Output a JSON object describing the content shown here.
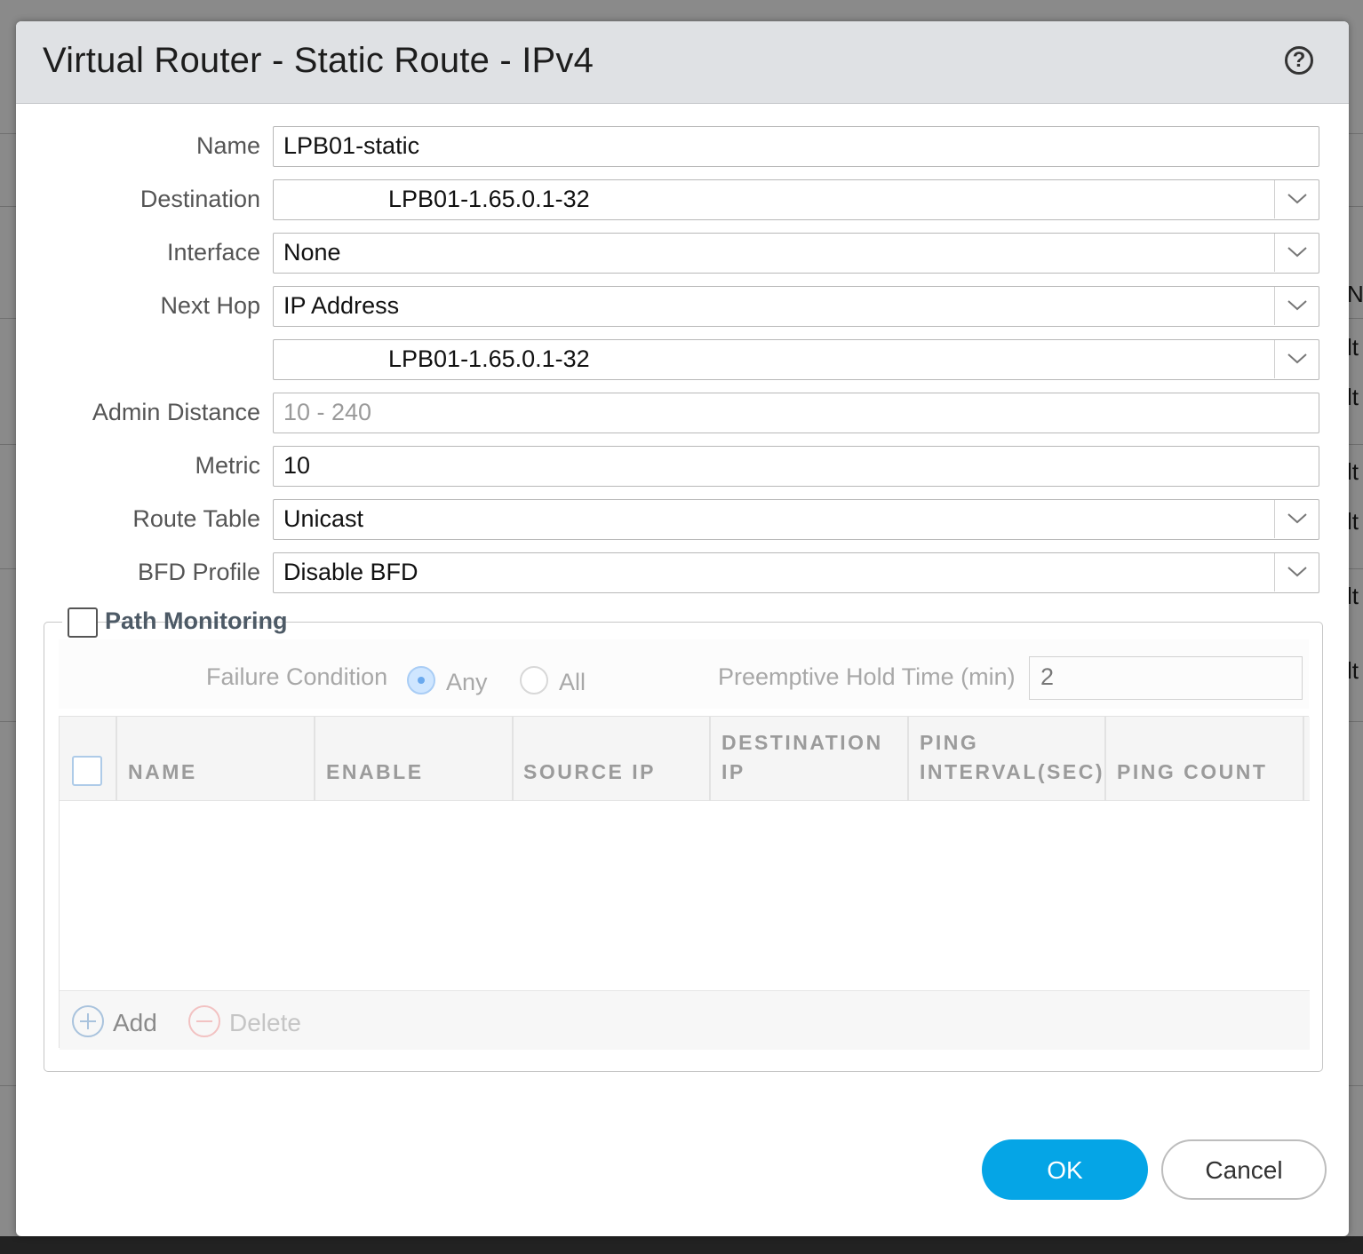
{
  "dialog": {
    "title": "Virtual Router - Static Route - IPv4",
    "help_glyph": "?"
  },
  "form": {
    "name_label": "Name",
    "name_value": "LPB01-static",
    "destination_label": "Destination",
    "destination_value": "LPB01-1.65.0.1-32",
    "interface_label": "Interface",
    "interface_value": "None",
    "next_hop_label": "Next Hop",
    "next_hop_type": "IP Address",
    "next_hop_value": "LPB01-1.65.0.1-32",
    "admin_distance_label": "Admin Distance",
    "admin_distance_placeholder": "10 - 240",
    "metric_label": "Metric",
    "metric_value": "10",
    "route_table_label": "Route Table",
    "route_table_value": "Unicast",
    "bfd_profile_label": "BFD Profile",
    "bfd_profile_value": "Disable BFD"
  },
  "path_monitoring": {
    "label": "Path Monitoring",
    "checked": false,
    "failure_condition_label": "Failure Condition",
    "option_any": "Any",
    "option_all": "All",
    "selected": "Any",
    "preemptive_label": "Preemptive Hold Time (min)",
    "preemptive_value": "2",
    "columns": [
      "NAME",
      "ENABLE",
      "SOURCE IP",
      "DESTINATION IP",
      "PING INTERVAL(SEC)",
      "PING COUNT"
    ],
    "col_dest_line1": "DESTINATION",
    "col_dest_line2": "IP",
    "col_interval_line1": "PING",
    "col_interval_line2": "INTERVAL(SEC)",
    "rows": [],
    "add_label": "Add",
    "delete_label": "Delete"
  },
  "buttons": {
    "ok": "OK",
    "cancel": "Cancel"
  },
  "background": {
    "fragments": [
      "N",
      "lt",
      "lt",
      "lt",
      "lt",
      "lt",
      "lt"
    ]
  },
  "colors": {
    "primary": "#05a5e6",
    "header_bg": "#dfe1e4"
  }
}
